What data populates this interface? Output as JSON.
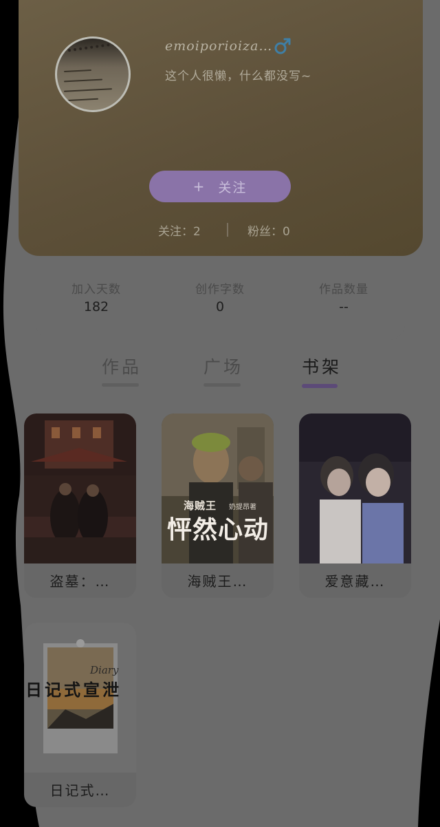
{
  "profile": {
    "username": "emoiporioiza…",
    "bio": "这个人很懒，什么都没写~",
    "gender_icon": "male-icon",
    "follow_button": {
      "plus": "+",
      "label": "关注"
    },
    "following": "关注：2",
    "followers": "粉丝：0"
  },
  "stats": [
    {
      "label": "加入天数",
      "value": "182"
    },
    {
      "label": "创作字数",
      "value": "0"
    },
    {
      "label": "作品数量",
      "value": "--"
    }
  ],
  "tabs": [
    {
      "label": "作品",
      "active": false
    },
    {
      "label": "广场",
      "active": false
    },
    {
      "label": "书架",
      "active": true
    }
  ],
  "books": [
    {
      "title": "盗墓：…"
    },
    {
      "title": "海贼王…",
      "cover_text": {
        "small": "海贼王",
        "big": "怦然心动",
        "author": "奶提昂著"
      }
    },
    {
      "title": "爱意藏…"
    },
    {
      "title": "日记式…",
      "cover_text": {
        "big": "日记式宣泄",
        "script": "Diary"
      }
    }
  ],
  "colors": {
    "accent": "#8a73a8",
    "header_bg": "#5d5039",
    "page_bg": "#6b6b6b",
    "backdrop": "#000000"
  }
}
